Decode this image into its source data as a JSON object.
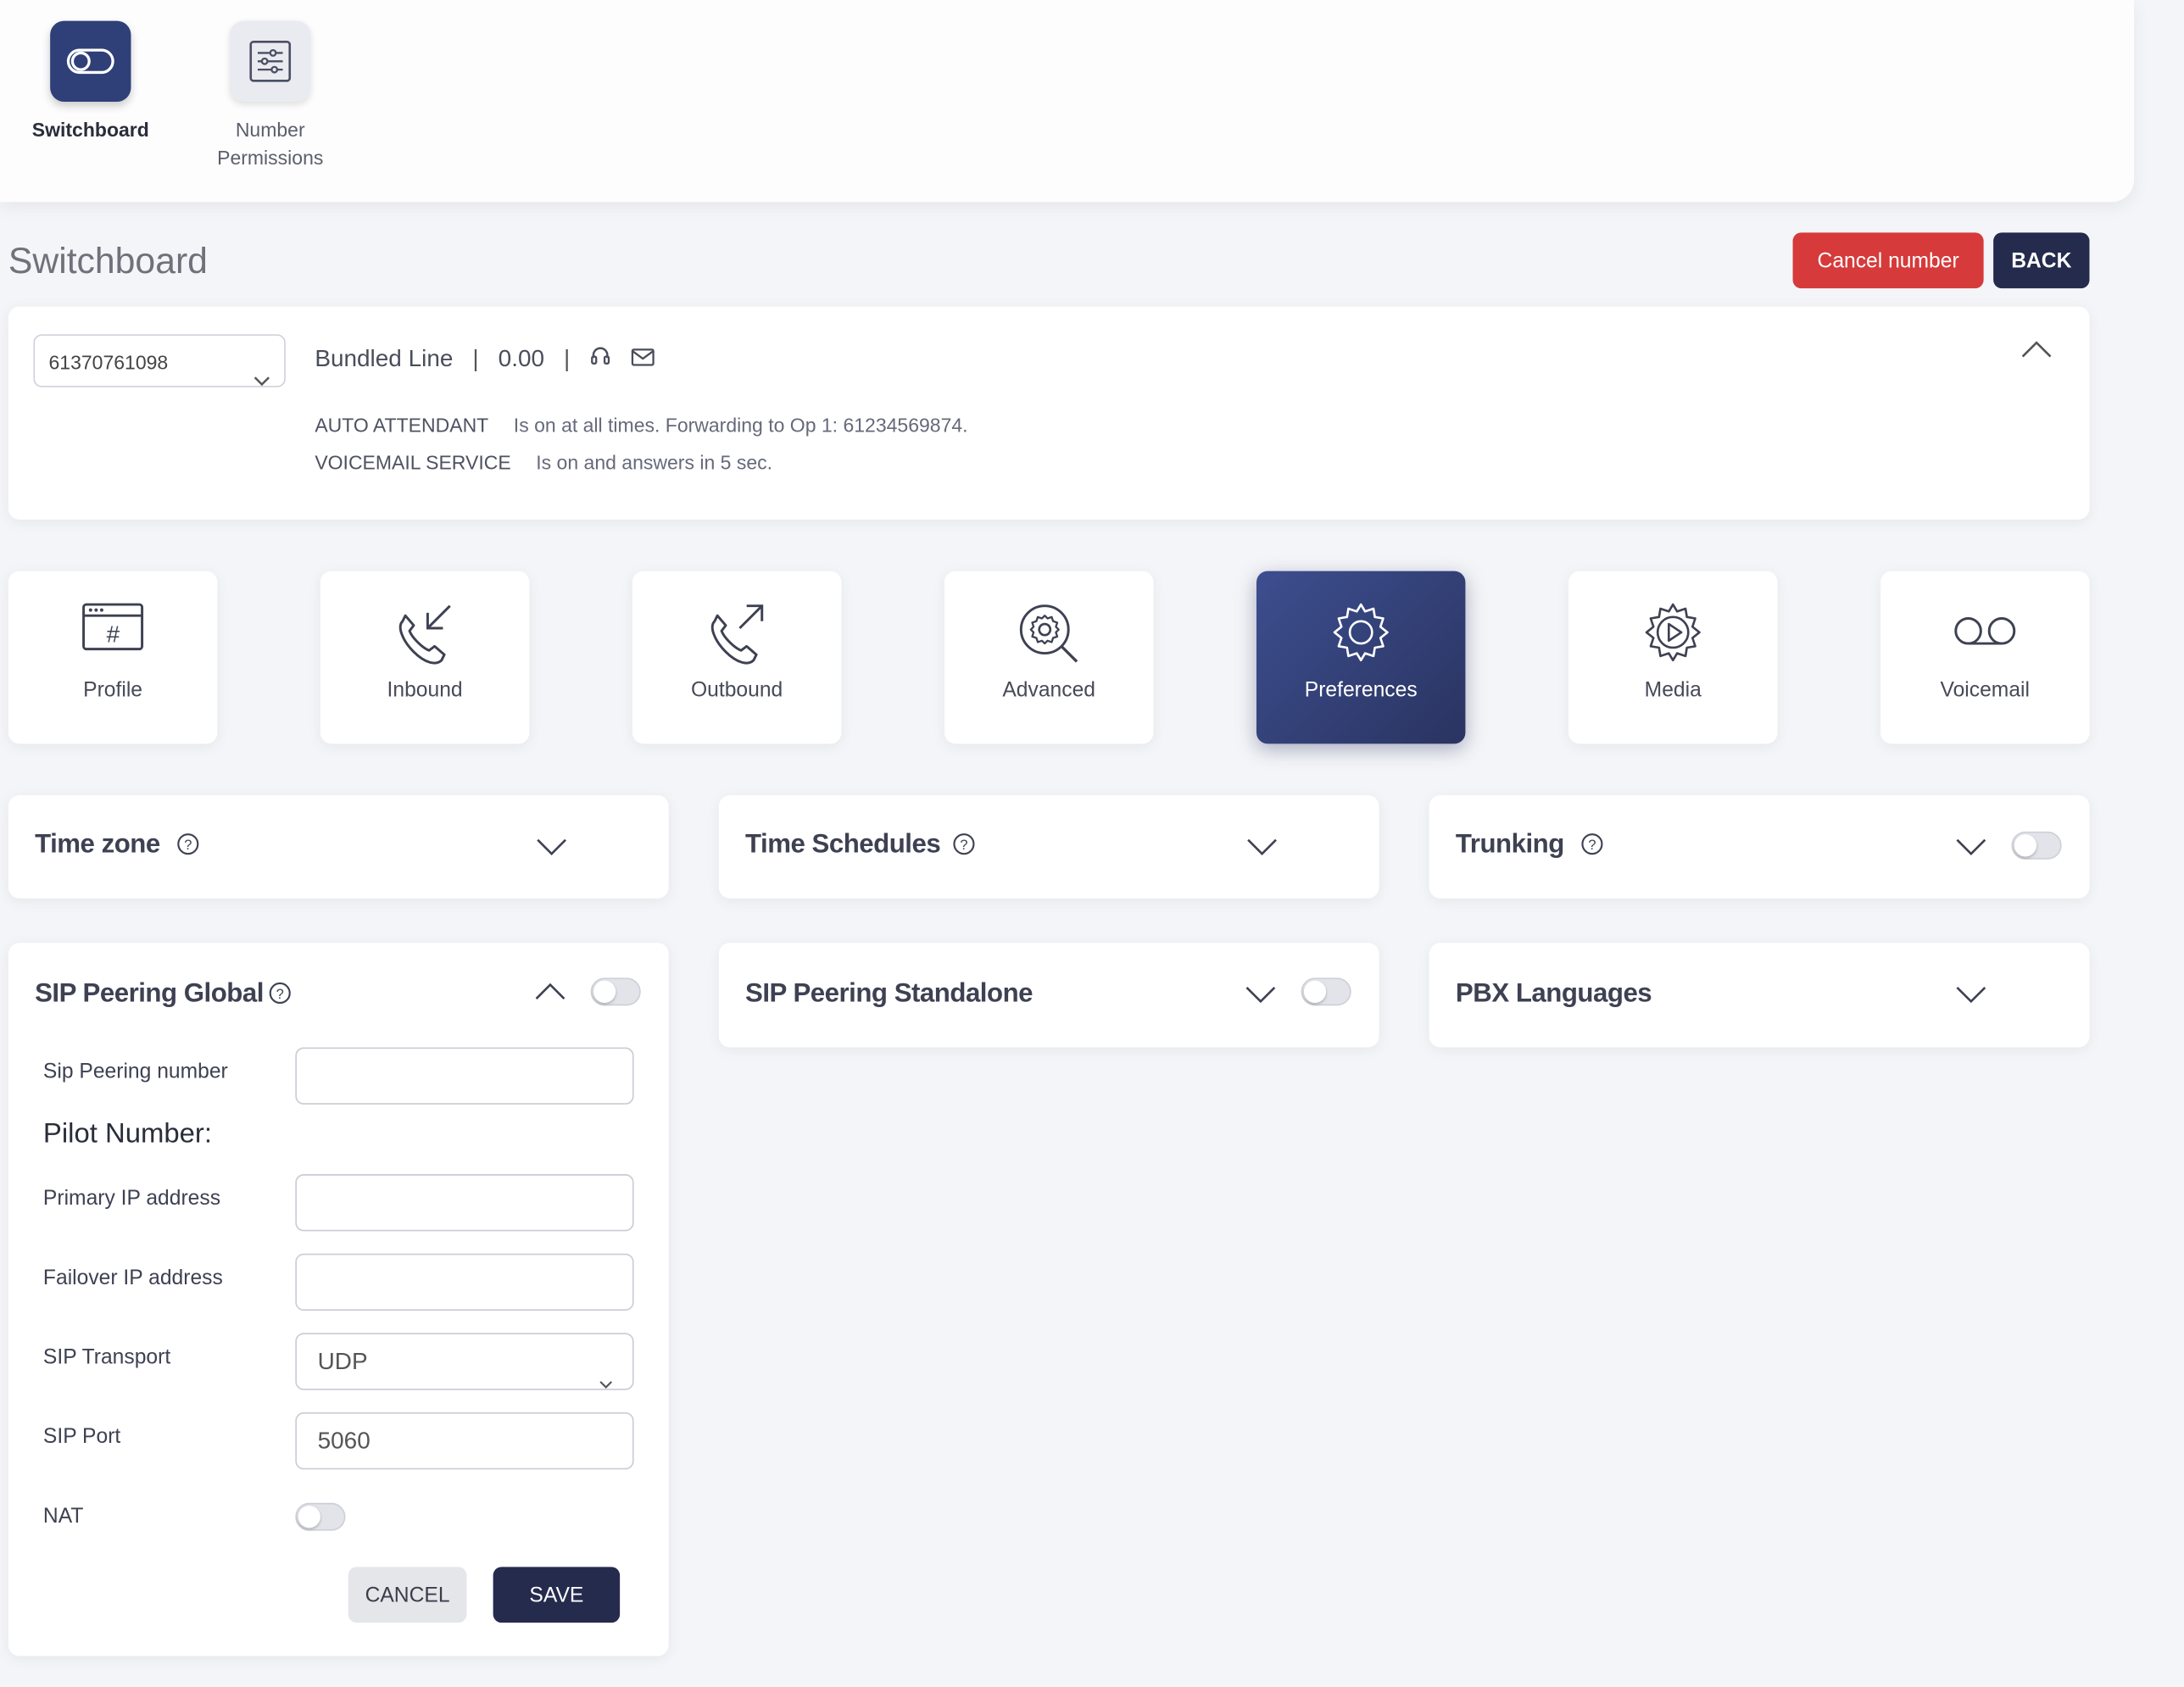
{
  "apps": [
    {
      "label": "Switchboard",
      "icon": "toggle-switch-icon",
      "active": true
    },
    {
      "label": "Number Permissions",
      "icon": "sliders-list-icon",
      "active": false
    }
  ],
  "page": {
    "title": "Switchboard"
  },
  "actions": {
    "cancel_number": "Cancel number",
    "back": "BACK"
  },
  "number_card": {
    "selected_number": "61370761098",
    "line_type": "Bundled Line",
    "balance": "0.00",
    "separator": "|",
    "icons": [
      "headset-icon",
      "mail-icon"
    ],
    "status": [
      {
        "key": "AUTO ATTENDANT",
        "value": "Is on at all times. Forwarding to Op 1: 61234569874."
      },
      {
        "key": "VOICEMAIL SERVICE",
        "value": "Is on and answers in 5 sec."
      }
    ]
  },
  "nav_tiles": [
    {
      "label": "Profile",
      "icon": "profile-hash-icon"
    },
    {
      "label": "Inbound",
      "icon": "phone-inbound-icon"
    },
    {
      "label": "Outbound",
      "icon": "phone-outbound-icon"
    },
    {
      "label": "Advanced",
      "icon": "gear-search-icon"
    },
    {
      "label": "Preferences",
      "icon": "gear-icon",
      "active": true
    },
    {
      "label": "Media",
      "icon": "gear-play-icon"
    },
    {
      "label": "Voicemail",
      "icon": "voicemail-icon"
    }
  ],
  "panels": {
    "time_zone": {
      "title": "Time zone"
    },
    "time_schedules": {
      "title": "Time Schedules"
    },
    "trunking": {
      "title": "Trunking",
      "enabled": false
    },
    "sip_peering_global": {
      "title": "SIP Peering Global",
      "enabled": false,
      "fields": {
        "sip_peering_number": {
          "label": "Sip Peering number",
          "value": ""
        },
        "pilot_number": "Pilot Number:",
        "primary_ip": {
          "label": "Primary IP address",
          "value": ""
        },
        "failover_ip": {
          "label": "Failover IP address",
          "value": ""
        },
        "sip_transport": {
          "label": "SIP Transport",
          "value": "UDP"
        },
        "sip_port": {
          "label": "SIP Port",
          "value": "5060"
        },
        "nat": {
          "label": "NAT",
          "enabled": false
        }
      },
      "cancel": "CANCEL",
      "save": "SAVE"
    },
    "sip_peering_standalone": {
      "title": "SIP Peering Standalone",
      "enabled": false
    },
    "pbx_languages": {
      "title": "PBX Languages"
    }
  },
  "colors": {
    "primary": "#2f3f78",
    "danger": "#d63a3a",
    "dark": "#252b4d",
    "background": "#f4f5f8"
  }
}
